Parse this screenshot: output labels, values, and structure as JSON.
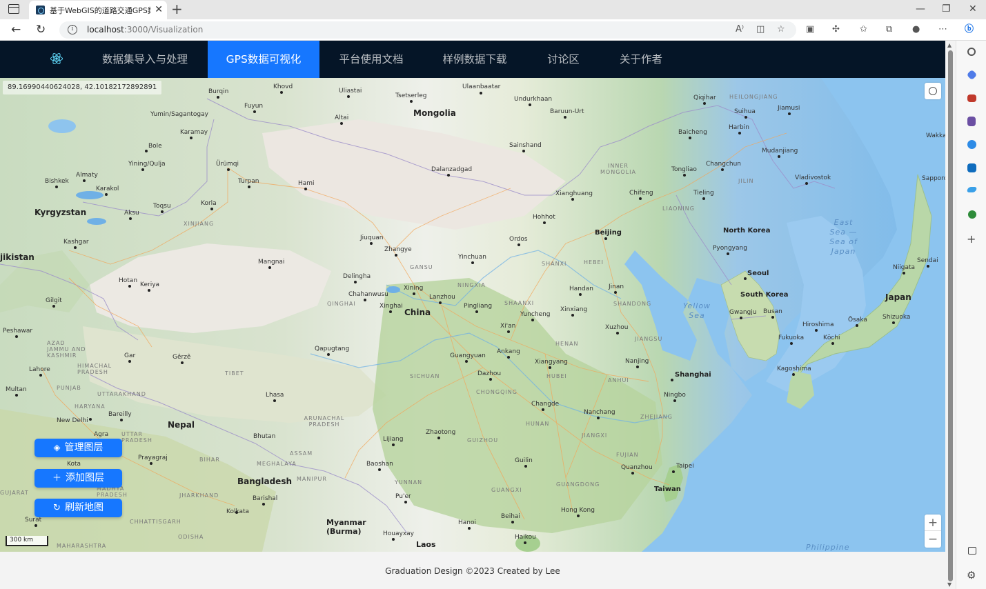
{
  "browser": {
    "tab_title": "基于WebGIS的道路交通GPS数据",
    "url_host": "localhost",
    "url_path": ":3000/Visualization"
  },
  "nav": {
    "items": [
      {
        "label": "数据集导入与处理",
        "active": false
      },
      {
        "label": "GPS数据可视化",
        "active": true
      },
      {
        "label": "平台使用文档",
        "active": false
      },
      {
        "label": "样例数据下载",
        "active": false
      },
      {
        "label": "讨论区",
        "active": false
      },
      {
        "label": "关于作者",
        "active": false
      }
    ]
  },
  "map": {
    "cursor_coords": "89.16990440624028, 42.10182172892891",
    "scale_label": "300 km",
    "labels": {
      "burqin": "Burqin",
      "khovd": "Khovd",
      "uliastai": "Uliastai",
      "ulaanbaatar": "Ulaanbaatar",
      "tsetserleg": "Tsetserleg",
      "undurkhaan": "Undurkhaan",
      "qiqihar": "Qiqihar",
      "heilongjiang": "HEILONGJIANG",
      "fuyun": "Fuyun",
      "mongolia": "Mongolia",
      "baruun_urt": "Baruun-Urt",
      "suihua": "Suihua",
      "jiamusi": "Jiamusi",
      "yumin": "Yumin/Sagantogay",
      "altai": "Altai",
      "karamay": "Karamay",
      "baicheng": "Baicheng",
      "harbin": "Harbin",
      "wakkanai": "Wakkan",
      "bole": "Bole",
      "sainshand": "Sainshand",
      "mudanjiang": "Mudanjiang",
      "yining": "Yining/Qulja",
      "urumqi": "Ürümqi",
      "dalanzadgad": "Dalanzadgad",
      "inner_mongolia": "INNER MONGOLIA",
      "changchun": "Changchun",
      "tongliao": "Tongliao",
      "almaty": "Almaty",
      "turpan": "Turpan",
      "hami": "Hami",
      "jilin": "JILIN",
      "vladivostok": "Vladivostok",
      "sapporo": "Sapporo",
      "bishkek": "Bishkek",
      "karakol": "Karakol",
      "xianghuang": "Xianghuang",
      "chifeng": "Chifeng",
      "tieling": "Tieling",
      "toqsu": "Toqsu",
      "korla": "Korla",
      "liaoning": "LIAONING",
      "kyrgyzstan": "Kyrgyzstan",
      "aksu": "Aksu",
      "hohhot": "Hohhot",
      "xinjiang": "XINJIANG",
      "east_sea": "East Sea — Sea of Japan",
      "north_korea": "North Korea",
      "beijing": "Beijing",
      "jiuquan": "Jiuquan",
      "kashgar": "Kashgar",
      "ordos": "Ordos",
      "zhangye": "Zhangye",
      "pyongyang": "Pyongyang",
      "tajikistan": "jikistan",
      "yinchuan": "Yinchuan",
      "mangnai": "Mangnai",
      "gansu": "GANSU",
      "shanxi": "SHANXI",
      "hebei": "HEBEI",
      "niigata": "Niigata",
      "sendai": "Sendai",
      "delingha": "Delingha",
      "seoul": "Seoul",
      "hotan": "Hotan",
      "keriya": "Keriya",
      "ningxia": "NINGXIA",
      "handan": "Handan",
      "jinan": "Jinan",
      "xining": "Xining",
      "lanzhou": "Lanzhou",
      "chahanwusu": "Chahanwusu",
      "gilgit": "Gilgit",
      "qinghai": "QINGHAI",
      "shaanxi": "SHAANXI",
      "shandong": "SHANDONG",
      "south_korea": "South Korea",
      "japan": "Japan",
      "pingliang": "Pingliang",
      "xinghai": "Xinghai",
      "yellow_sea": "Yellow Sea",
      "china": "China",
      "yuncheng": "Yuncheng",
      "xinxiang": "Xinxiang",
      "gwangju": "Gwangju",
      "busan": "Busan",
      "hiroshima": "Hiroshima",
      "osaka": "Ōsaka",
      "shizuoka": "Shizuoka",
      "peshawar": "Peshawar",
      "xian": "Xi'an",
      "xuzhou": "Xuzhou",
      "fukuoka": "Fukuoka",
      "kochi": "Kōchi",
      "henan": "HENAN",
      "jiangsu": "JIANGSU",
      "qapugtang": "Qapugtang",
      "guangyuan": "Guangyuan",
      "ankang": "Ankang",
      "azad_kashmir": "AZAD JAMMU AND KASHMIR",
      "gerze": "Gêrzê",
      "gar": "Gar",
      "xiangyang": "Xiangyang",
      "nanjing": "Nanjing",
      "lahore": "Lahore",
      "himachal": "HIMACHAL PRADESH",
      "tibet": "TIBET",
      "sichuan": "SICHUAN",
      "dazhou": "Dazhou",
      "hubei": "HUBEI",
      "anhui": "ANHUI",
      "shanghai": "Shanghai",
      "kagoshima": "Kagoshima",
      "multan": "Multan",
      "punjab": "PUNJAB",
      "uttarakhand": "UTTARAKHAND",
      "lhasa": "Lhasa",
      "chongqing": "CHONGQING",
      "ningbo": "Ningbo",
      "changde": "Changde",
      "nanchang": "Nanchang",
      "bareilly": "Bareilly",
      "haryana": "HARYANA",
      "new_delhi": "New Delhi",
      "nepal": "Nepal",
      "arunachal": "ARUNACHAL PRADESH",
      "hunan": "HUNAN",
      "zhejiang": "ZHEJIANG",
      "agra": "Agra",
      "uttar_pradesh": "UTTAR PRADESH",
      "bhutan": "Bhutan",
      "lijiang": "Lijiang",
      "zhaotong": "Zhaotong",
      "guizhou": "GUIZHOU",
      "jiangxi": "JIANGXI",
      "assam": "ASSAM",
      "prayagraj": "Prayagraj",
      "bihar": "BIHAR",
      "meghalaya": "MEGHALAYA",
      "guilin": "Guilin",
      "fujian": "FUJIAN",
      "kota": "Kota",
      "taipei": "Taipei",
      "quanzhou": "Quanzhou",
      "baoshan": "Baoshan",
      "yunnan": "YUNNAN",
      "bangladesh": "Bangladesh",
      "manipur": "MANIPUR",
      "guangxi": "GUANGXI",
      "guangdong": "GUANGDONG",
      "gujarat": "GUJARAT",
      "madhya": "MADHYA PRADESH",
      "jharkhand": "JHARKHAND",
      "barishal": "Barishal",
      "puer": "Pu'er",
      "taiwan": "Taiwan",
      "hong_kong": "Hong Kong",
      "kolkata": "Kolkata",
      "surat": "Surat",
      "chhattisgarh": "CHHATTISGARH",
      "myanmar": "Myanmar (Burma)",
      "hanoi": "Hanoi",
      "beihai": "Beihai",
      "houayxay": "Houayxay",
      "haikou": "Haikou",
      "odisha": "ODISHA",
      "maharashtra": "MAHARASHTRA",
      "laos": "Laos",
      "philippine_sea": "Philippine"
    }
  },
  "buttons": {
    "manage_layers": "管理图层",
    "add_layer": "添加图层",
    "refresh_map": "刷新地图"
  },
  "footer": {
    "text": "Graduation Design ©2023 Created by Lee"
  },
  "colors": {
    "nav_bg": "#051527",
    "accent": "#1677ff"
  }
}
